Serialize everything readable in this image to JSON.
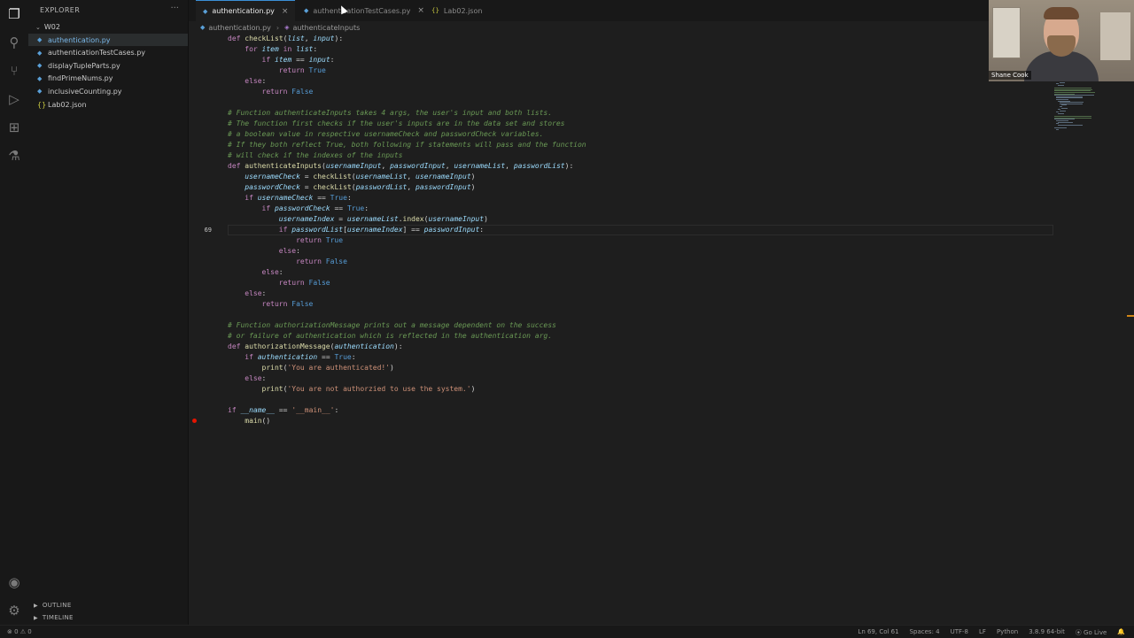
{
  "sidebar": {
    "title": "EXPLORER",
    "more": "···",
    "folder": "W02",
    "files": [
      {
        "name": "authentication.py",
        "type": "py",
        "active": true
      },
      {
        "name": "authenticationTestCases.py",
        "type": "py",
        "active": false
      },
      {
        "name": "displayTupleParts.py",
        "type": "py",
        "active": false
      },
      {
        "name": "findPrimeNums.py",
        "type": "py",
        "active": false
      },
      {
        "name": "inclusiveCounting.py",
        "type": "py",
        "active": false
      },
      {
        "name": "Lab02.json",
        "type": "json",
        "active": false
      }
    ],
    "outline": "OUTLINE",
    "timeline": "TIMELINE"
  },
  "tabs": [
    {
      "label": "authentication.py",
      "active": true,
      "close": "×"
    },
    {
      "label": "authenticationTestCases.py",
      "active": false,
      "close": "×"
    },
    {
      "label": "Lab02.json",
      "active": false,
      "close": ""
    }
  ],
  "breadcrumb": {
    "file": "authentication.py",
    "symbol": "authenticateInputs"
  },
  "editor": {
    "current_line": "69",
    "lines": [
      {
        "n": "",
        "t": "def checkList(list, input):"
      },
      {
        "n": "",
        "t": "    for item in list:"
      },
      {
        "n": "",
        "t": "        if item == input:"
      },
      {
        "n": "",
        "t": "            return True"
      },
      {
        "n": "",
        "t": "    else:"
      },
      {
        "n": "",
        "t": "        return False"
      },
      {
        "n": "",
        "t": ""
      },
      {
        "n": "",
        "t": "# Function authenticateInputs takes 4 args, the user's input and both lists."
      },
      {
        "n": "",
        "t": "# The function first checks if the user's inputs are in the data set and stores"
      },
      {
        "n": "",
        "t": "# a boolean value in respective usernameCheck and passwordCheck variables."
      },
      {
        "n": "",
        "t": "# If they both reflect True, both following if statements will pass and the function"
      },
      {
        "n": "",
        "t": "# will check if the indexes of the inputs"
      },
      {
        "n": "",
        "t": "def authenticateInputs(usernameInput, passwordInput, usernameList, passwordList):"
      },
      {
        "n": "",
        "t": "    usernameCheck = checkList(usernameList, usernameInput)"
      },
      {
        "n": "",
        "t": "    passwordCheck = checkList(passwordList, passwordInput)"
      },
      {
        "n": "",
        "t": "    if usernameCheck == True:"
      },
      {
        "n": "",
        "t": "        if passwordCheck == True:"
      },
      {
        "n": "",
        "t": "            usernameIndex = usernameList.index(usernameInput)"
      },
      {
        "n": "69",
        "t": "            if passwordList[usernameIndex] == passwordInput:"
      },
      {
        "n": "",
        "t": "                return True"
      },
      {
        "n": "",
        "t": "            else:"
      },
      {
        "n": "",
        "t": "                return False"
      },
      {
        "n": "",
        "t": "        else:"
      },
      {
        "n": "",
        "t": "            return False"
      },
      {
        "n": "",
        "t": "    else:"
      },
      {
        "n": "",
        "t": "        return False"
      },
      {
        "n": "",
        "t": ""
      },
      {
        "n": "",
        "t": "# Function authorizationMessage prints out a message dependent on the success"
      },
      {
        "n": "",
        "t": "# or failure of authentication which is reflected in the authentication arg."
      },
      {
        "n": "",
        "t": "def authorizationMessage(authentication):"
      },
      {
        "n": "",
        "t": "    if authentication == True:"
      },
      {
        "n": "",
        "t": "        print('You are authenticated!')"
      },
      {
        "n": "",
        "t": "    else:"
      },
      {
        "n": "",
        "t": "        print('You are not authorzied to use the system.')"
      },
      {
        "n": "",
        "t": ""
      },
      {
        "n": "",
        "t": "if __name__ == '__main__':"
      },
      {
        "n": "",
        "t": "    main()"
      }
    ]
  },
  "webcam": {
    "name": "Shane Cook"
  },
  "status": {
    "left": "⊗ 0  ⚠ 0",
    "position": "Ln 69, Col 61",
    "spaces": "Spaces: 4",
    "encoding": "UTF-8",
    "eol": "LF",
    "language": "Python",
    "interpreter": "3.8.9 64-bit",
    "golive": "⦿ Go Live",
    "bell": "🔔"
  }
}
